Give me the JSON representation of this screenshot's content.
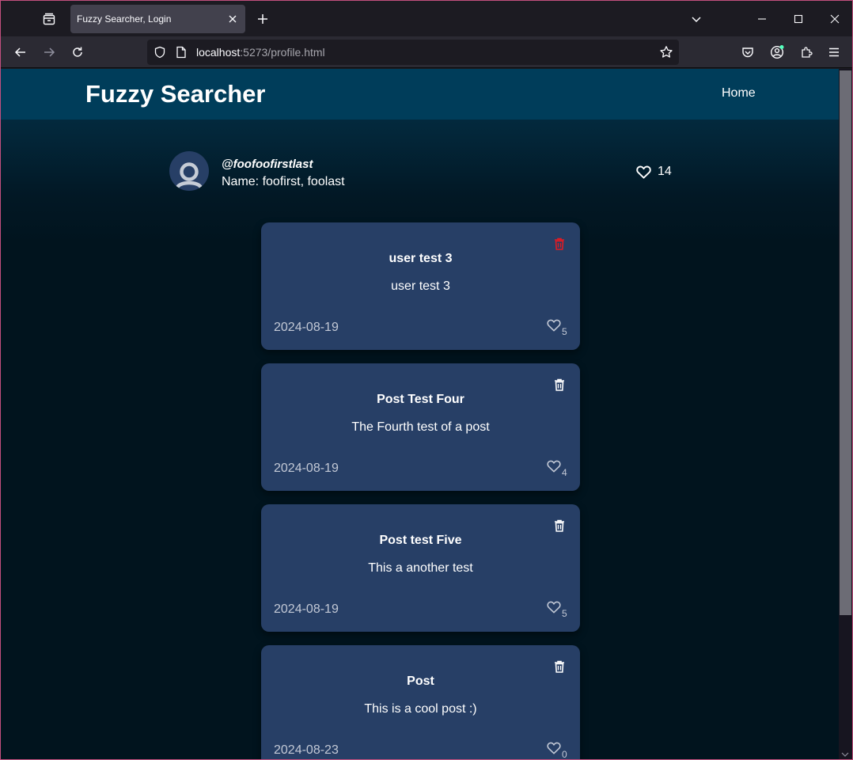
{
  "browser": {
    "tab_title": "Fuzzy Searcher, Login",
    "url_host": "localhost",
    "url_rest": ":5273/profile.html"
  },
  "site": {
    "brand": "Fuzzy Searcher",
    "nav_home": "Home"
  },
  "profile": {
    "handle": "@foofoofirstlast",
    "name": "Name: foofirst, foolast",
    "total_likes": "14"
  },
  "posts": [
    {
      "title": "user test 3",
      "body": "user test 3",
      "date": "2024-08-19",
      "likes": "5",
      "delete_icon_color": "#e01b24"
    },
    {
      "title": "Post Test Four",
      "body": "The Fourth test of a post",
      "date": "2024-08-19",
      "likes": "4",
      "delete_icon_color": "#ffffff"
    },
    {
      "title": "Post test Five",
      "body": "This a another test",
      "date": "2024-08-19",
      "likes": "5",
      "delete_icon_color": "#ffffff"
    },
    {
      "title": "Post",
      "body": "This is a cool post :)",
      "date": "2024-08-23",
      "likes": "0",
      "delete_icon_color": "#ffffff"
    }
  ],
  "icons": {
    "tab_list": "tab-list-icon",
    "close_tab": "close-icon",
    "new_tab": "plus-icon",
    "back": "arrow-left-icon",
    "forward": "arrow-right-icon",
    "reload": "reload-icon",
    "site_info": "shield-icon",
    "page": "page-icon",
    "bookmark": "star-icon",
    "pocket": "pocket-icon",
    "account": "account-icon",
    "extensions": "puzzle-icon",
    "menu": "hamburger-icon",
    "likes": "heart-icon",
    "delete": "trash-icon",
    "avatar": "user-icon"
  }
}
